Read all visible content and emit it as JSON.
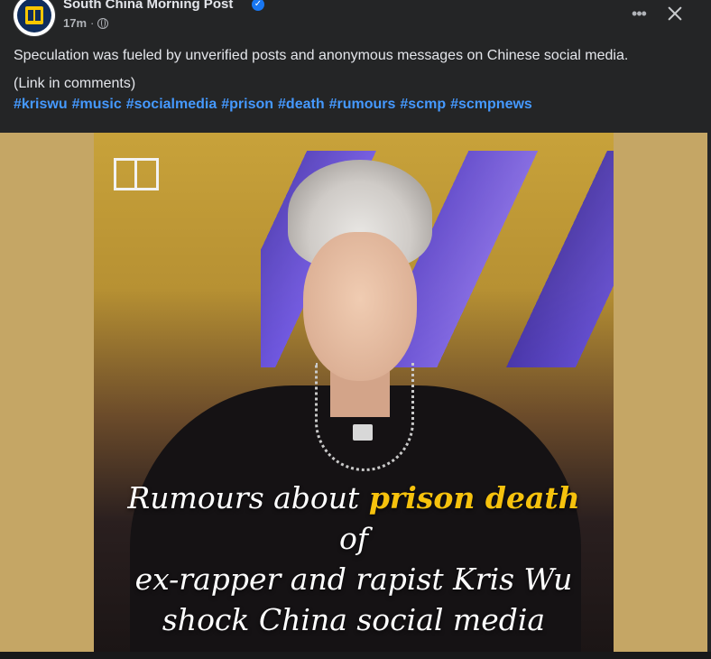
{
  "post": {
    "page_name": "South China Morning Post",
    "timestamp": "17m",
    "separator": "·",
    "text_line1": "Speculation was fueled by unverified posts and anonymous messages on Chinese social media.",
    "text_line2": "(Link in comments)",
    "hashtags": [
      "#kriswu",
      "#music",
      "#socialmedia",
      "#prison",
      "#death",
      "#rumours",
      "#scmp",
      "#scmpnews"
    ]
  },
  "header": {
    "more_label": "•••"
  },
  "media": {
    "title_before": "Rumours about ",
    "title_highlight": "prison death",
    "title_after": " of",
    "title_line2": "ex-rapper and rapist Kris Wu",
    "title_line3": "shock China social media",
    "highlight_color": "#f6c20d",
    "frame_color": "#c5a665"
  },
  "colors": {
    "background": "#242526",
    "link": "#4599ff",
    "text": "#e4e6eb",
    "secondary_text": "#b0b3b8"
  }
}
